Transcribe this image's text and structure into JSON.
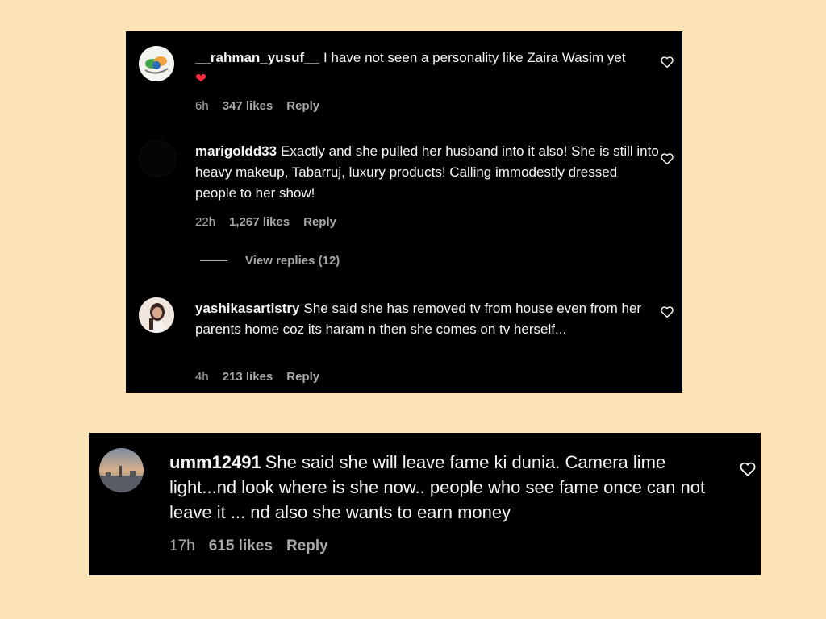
{
  "comments": [
    {
      "username": "__rahman_yusuf__",
      "text": "I have not seen a personality like Zaira Wasim yet",
      "emoji": "❤",
      "time": "6h",
      "likes": "347 likes",
      "reply": "Reply"
    },
    {
      "username": "marigoldd33",
      "text": "Exactly and she pulled her husband into it also! She is still into heavy makeup, Tabarruj, luxury products! Calling immodestly dressed people to her show!",
      "time": "22h",
      "likes": "1,267 likes",
      "reply": "Reply",
      "view_replies": "View replies (12)"
    },
    {
      "username": "yashikasartistry",
      "text": "She said she has removed tv from house even from her parents home coz its haram n then she comes on tv herself...",
      "time": "4h",
      "likes": "213 likes",
      "reply": "Reply"
    },
    {
      "username": "umm12491",
      "text": "She said she will leave fame ki dunia. Camera lime light...nd look where is she now.. people who see fame once can not leave it ... nd also she wants to earn money",
      "time": "17h",
      "likes": "615 likes",
      "reply": "Reply"
    }
  ],
  "colors": {
    "background": "#fde4b6",
    "panel": "#000000",
    "text": "#f5f5f5",
    "muted": "#a8a8a8",
    "heart_emoji": "#ff2a3a"
  },
  "icons": {
    "like": "heart-outline-icon"
  }
}
